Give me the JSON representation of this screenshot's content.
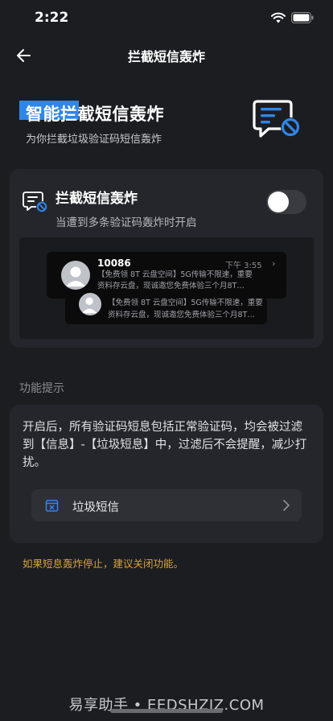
{
  "status_bar": {
    "time": "2:22"
  },
  "nav": {
    "title": "拦截短信轰炸"
  },
  "hero": {
    "title": "智能拦截短信轰炸",
    "subtitle": "为你拦截垃圾验证码短信轰炸",
    "icon": "blocked-message-icon"
  },
  "toggle_card": {
    "title": "拦截短信轰炸",
    "description": "当遭到多条验证码轰炸时开启",
    "enabled": false,
    "preview": {
      "message_1": {
        "sender": "10086",
        "time": "下午 3:55",
        "line_1": "【免费领 8T 云盘空间】5G传输不限速，重要",
        "line_2": "资料存云盘，现诚邀您免费体验三个月8T…"
      },
      "message_2": {
        "line_1": "【免费领 8T 云盘空间】5G传输不限速，重要",
        "line_2": "资料存云盘，现诚邀您免费体验三个月8T…"
      }
    }
  },
  "section": {
    "label": "功能提示"
  },
  "info_card": {
    "text": "开启后，所有验证码短息包括正常验证码，均会被过滤到【信息】-【垃圾短息】中，过滤后不会提醒，减少打扰。",
    "junk_row_label": "垃圾短信"
  },
  "warning": "如果短息轰炸停止，建议关闭功能。",
  "watermark": "易享助手 • EEDSHZJZ.COM",
  "colors": {
    "accent": "#2f86e8",
    "warning": "#d8a43a",
    "background": "#1c1d21",
    "card": "#25262b"
  }
}
